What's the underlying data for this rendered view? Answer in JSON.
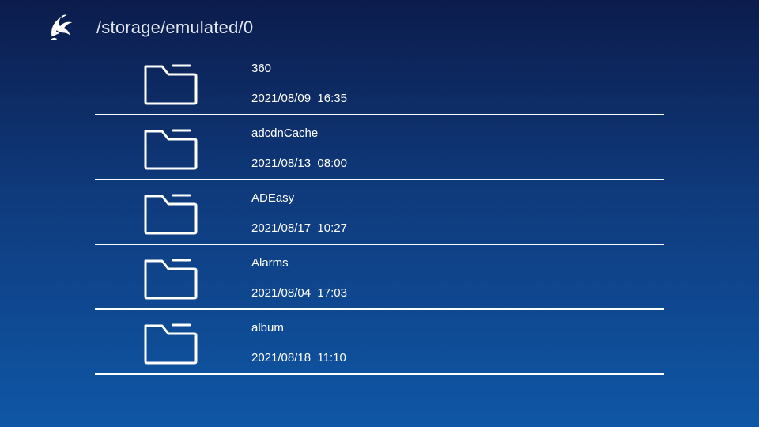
{
  "header": {
    "logo_icon": "dolphin-logo-icon",
    "path": "/storage/emulated/0"
  },
  "files": [
    {
      "name": "360",
      "date": "2021/08/09  16:35",
      "icon": "folder-icon"
    },
    {
      "name": "adcdnCache",
      "date": "2021/08/13  08:00",
      "icon": "folder-icon"
    },
    {
      "name": "ADEasy",
      "date": "2021/08/17  10:27",
      "icon": "folder-icon"
    },
    {
      "name": "Alarms",
      "date": "2021/08/04  17:03",
      "icon": "folder-icon"
    },
    {
      "name": "album",
      "date": "2021/08/18  11:10",
      "icon": "folder-icon"
    }
  ],
  "colors": {
    "background_top": "#0c1c4c",
    "background_bottom": "#0f57a6",
    "text": "#ffffff",
    "divider": "#ffffff"
  }
}
